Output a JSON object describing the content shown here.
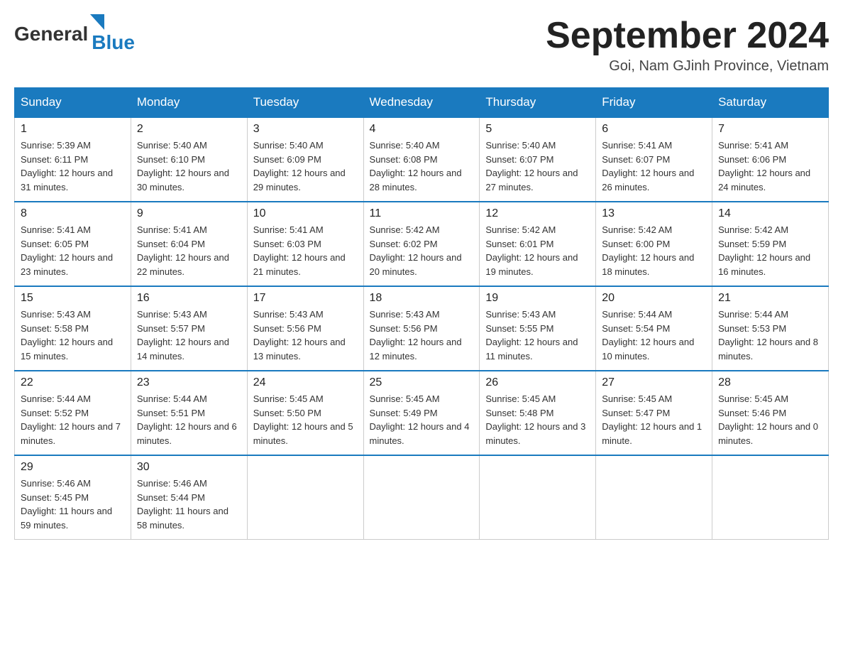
{
  "header": {
    "logo": {
      "general": "General",
      "blue": "Blue",
      "arrow": "▶"
    },
    "title": "September 2024",
    "location": "Goi, Nam GJinh Province, Vietnam"
  },
  "weekdays": [
    "Sunday",
    "Monday",
    "Tuesday",
    "Wednesday",
    "Thursday",
    "Friday",
    "Saturday"
  ],
  "weeks": [
    [
      {
        "day": "1",
        "sunrise": "5:39 AM",
        "sunset": "6:11 PM",
        "daylight": "12 hours and 31 minutes."
      },
      {
        "day": "2",
        "sunrise": "5:40 AM",
        "sunset": "6:10 PM",
        "daylight": "12 hours and 30 minutes."
      },
      {
        "day": "3",
        "sunrise": "5:40 AM",
        "sunset": "6:09 PM",
        "daylight": "12 hours and 29 minutes."
      },
      {
        "day": "4",
        "sunrise": "5:40 AM",
        "sunset": "6:08 PM",
        "daylight": "12 hours and 28 minutes."
      },
      {
        "day": "5",
        "sunrise": "5:40 AM",
        "sunset": "6:07 PM",
        "daylight": "12 hours and 27 minutes."
      },
      {
        "day": "6",
        "sunrise": "5:41 AM",
        "sunset": "6:07 PM",
        "daylight": "12 hours and 26 minutes."
      },
      {
        "day": "7",
        "sunrise": "5:41 AM",
        "sunset": "6:06 PM",
        "daylight": "12 hours and 24 minutes."
      }
    ],
    [
      {
        "day": "8",
        "sunrise": "5:41 AM",
        "sunset": "6:05 PM",
        "daylight": "12 hours and 23 minutes."
      },
      {
        "day": "9",
        "sunrise": "5:41 AM",
        "sunset": "6:04 PM",
        "daylight": "12 hours and 22 minutes."
      },
      {
        "day": "10",
        "sunrise": "5:41 AM",
        "sunset": "6:03 PM",
        "daylight": "12 hours and 21 minutes."
      },
      {
        "day": "11",
        "sunrise": "5:42 AM",
        "sunset": "6:02 PM",
        "daylight": "12 hours and 20 minutes."
      },
      {
        "day": "12",
        "sunrise": "5:42 AM",
        "sunset": "6:01 PM",
        "daylight": "12 hours and 19 minutes."
      },
      {
        "day": "13",
        "sunrise": "5:42 AM",
        "sunset": "6:00 PM",
        "daylight": "12 hours and 18 minutes."
      },
      {
        "day": "14",
        "sunrise": "5:42 AM",
        "sunset": "5:59 PM",
        "daylight": "12 hours and 16 minutes."
      }
    ],
    [
      {
        "day": "15",
        "sunrise": "5:43 AM",
        "sunset": "5:58 PM",
        "daylight": "12 hours and 15 minutes."
      },
      {
        "day": "16",
        "sunrise": "5:43 AM",
        "sunset": "5:57 PM",
        "daylight": "12 hours and 14 minutes."
      },
      {
        "day": "17",
        "sunrise": "5:43 AM",
        "sunset": "5:56 PM",
        "daylight": "12 hours and 13 minutes."
      },
      {
        "day": "18",
        "sunrise": "5:43 AM",
        "sunset": "5:56 PM",
        "daylight": "12 hours and 12 minutes."
      },
      {
        "day": "19",
        "sunrise": "5:43 AM",
        "sunset": "5:55 PM",
        "daylight": "12 hours and 11 minutes."
      },
      {
        "day": "20",
        "sunrise": "5:44 AM",
        "sunset": "5:54 PM",
        "daylight": "12 hours and 10 minutes."
      },
      {
        "day": "21",
        "sunrise": "5:44 AM",
        "sunset": "5:53 PM",
        "daylight": "12 hours and 8 minutes."
      }
    ],
    [
      {
        "day": "22",
        "sunrise": "5:44 AM",
        "sunset": "5:52 PM",
        "daylight": "12 hours and 7 minutes."
      },
      {
        "day": "23",
        "sunrise": "5:44 AM",
        "sunset": "5:51 PM",
        "daylight": "12 hours and 6 minutes."
      },
      {
        "day": "24",
        "sunrise": "5:45 AM",
        "sunset": "5:50 PM",
        "daylight": "12 hours and 5 minutes."
      },
      {
        "day": "25",
        "sunrise": "5:45 AM",
        "sunset": "5:49 PM",
        "daylight": "12 hours and 4 minutes."
      },
      {
        "day": "26",
        "sunrise": "5:45 AM",
        "sunset": "5:48 PM",
        "daylight": "12 hours and 3 minutes."
      },
      {
        "day": "27",
        "sunrise": "5:45 AM",
        "sunset": "5:47 PM",
        "daylight": "12 hours and 1 minute."
      },
      {
        "day": "28",
        "sunrise": "5:45 AM",
        "sunset": "5:46 PM",
        "daylight": "12 hours and 0 minutes."
      }
    ],
    [
      {
        "day": "29",
        "sunrise": "5:46 AM",
        "sunset": "5:45 PM",
        "daylight": "11 hours and 59 minutes."
      },
      {
        "day": "30",
        "sunrise": "5:46 AM",
        "sunset": "5:44 PM",
        "daylight": "11 hours and 58 minutes."
      },
      null,
      null,
      null,
      null,
      null
    ]
  ],
  "labels": {
    "sunrise": "Sunrise:",
    "sunset": "Sunset:",
    "daylight": "Daylight:"
  }
}
